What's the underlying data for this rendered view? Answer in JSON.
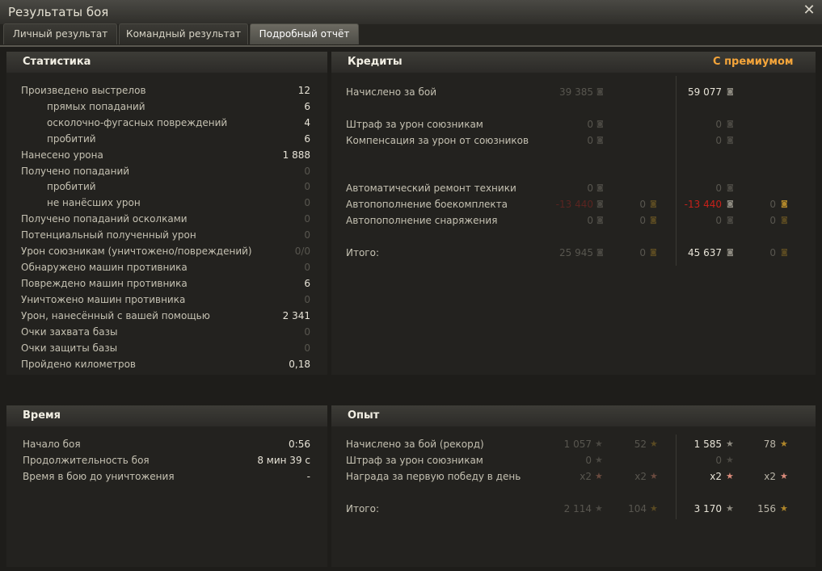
{
  "window": {
    "title": "Результаты боя",
    "close": "✕"
  },
  "tabs": [
    {
      "label": "Личный результат"
    },
    {
      "label": "Командный результат"
    },
    {
      "label": "Подробный отчёт"
    }
  ],
  "stats": {
    "title": "Статистика",
    "rows": [
      {
        "label": "Произведено выстрелов",
        "value": "12"
      },
      {
        "label": "прямых попаданий",
        "value": "6"
      },
      {
        "label": "осколочно-фугасных повреждений",
        "value": "4"
      },
      {
        "label": "пробитий",
        "value": "6"
      },
      {
        "label": "Нанесено урона",
        "value": "1 888"
      },
      {
        "label": "Получено попаданий",
        "value": "0"
      },
      {
        "label": "пробитий",
        "value": "0"
      },
      {
        "label": "не нанёсших урон",
        "value": "0"
      },
      {
        "label": "Получено попаданий осколками",
        "value": "0"
      },
      {
        "label": "Потенциальный полученный урон",
        "value": "0"
      },
      {
        "label": "Урон союзникам (уничтожено/повреждений)",
        "value": "0/0"
      },
      {
        "label": "Обнаружено машин противника",
        "value": "0"
      },
      {
        "label": "Повреждено машин противника",
        "value": "6"
      },
      {
        "label": "Уничтожено машин противника",
        "value": "0"
      },
      {
        "label": "Урон, нанесённый с вашей помощью",
        "value": "2 341"
      },
      {
        "label": "Очки захвата базы",
        "value": "0"
      },
      {
        "label": "Очки защиты базы",
        "value": "0"
      },
      {
        "label": "Пройдено километров",
        "value": "0,18"
      }
    ]
  },
  "credits": {
    "title": "Кредиты",
    "premium_label": "С премиумом",
    "rows": [
      {
        "label": "Начислено за бой",
        "base": "39 385",
        "prem": "59 077"
      },
      {
        "label": "Штраф за урон союзникам",
        "base": "0",
        "prem": "0"
      },
      {
        "label": "Компенсация за урон от союзников",
        "base": "0",
        "prem": "0"
      },
      {
        "label": "Автоматический ремонт техники",
        "base": "0",
        "prem": "0"
      },
      {
        "label": "Автопополнение боекомплекта",
        "base": "-13 440",
        "base_gold": "0",
        "prem": "-13 440",
        "prem_gold": "0"
      },
      {
        "label": "Автопополнение снаряжения",
        "base": "0",
        "base_gold": "0",
        "prem": "0",
        "prem_gold": "0"
      },
      {
        "label": "Итого:",
        "base": "25 945",
        "base_gold": "0",
        "prem": "45 637",
        "prem_gold": "0"
      }
    ]
  },
  "time": {
    "title": "Время",
    "rows": [
      {
        "label": "Начало боя",
        "value": "0:56"
      },
      {
        "label": "Продолжительность боя",
        "value": "8 мин 39 с"
      },
      {
        "label": "Время в бою до уничтожения",
        "value": "-"
      }
    ]
  },
  "exp": {
    "title": "Опыт",
    "rows": [
      {
        "label": "Начислено за бой (рекорд)",
        "base": "1 057",
        "base_free": "52",
        "prem": "1 585",
        "prem_free": "78"
      },
      {
        "label": "Штраф за урон союзникам",
        "base": "0",
        "prem": "0"
      },
      {
        "label": "Награда за первую победу в день",
        "base": "x2",
        "base_free": "x2",
        "prem": "x2",
        "prem_free": "x2"
      },
      {
        "label": "Итого:",
        "base": "2 114",
        "base_free": "104",
        "prem": "3 170",
        "prem_free": "156"
      }
    ]
  },
  "icons": {
    "credit": "credit-coin-icon",
    "gold": "gold-coin-icon",
    "xp": "xp-star-icon",
    "free_xp": "free-xp-star-icon"
  },
  "colors": {
    "premium": "#f5a53a",
    "negative": "#c6211a",
    "gold": "#b0872a"
  }
}
